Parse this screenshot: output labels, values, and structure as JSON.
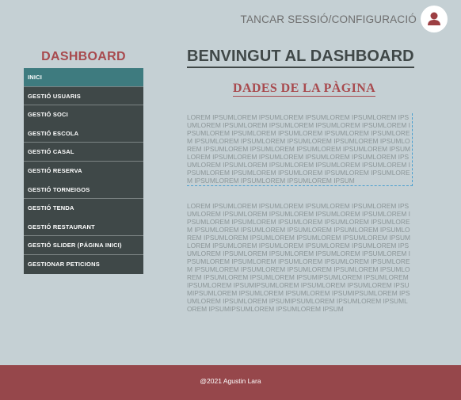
{
  "header": {
    "logout_label": "TANCAR SESSIÓ/CONFIGURACIÓ",
    "avatar_icon": "user-icon"
  },
  "sidebar": {
    "title": "DASHBOARD",
    "items": [
      {
        "label": "INICI",
        "active": true
      },
      {
        "label": "GESTIÓ USUARIS"
      },
      {
        "label": "GESTIÓ SOCI"
      },
      {
        "label": "GESTIÓ ESCOLA"
      },
      {
        "label": "GESTIÓ CASAL"
      },
      {
        "label": "GESTIÓ RESERVA"
      },
      {
        "label": "GESTIÓ TORNEIGOS"
      },
      {
        "label": "GESTIÓ TENDA"
      },
      {
        "label": "GESTIÓ RESTAURANT"
      },
      {
        "label": "GESTIÓ SLIDER (PÁGINA INICI)"
      },
      {
        "label": "GESTIONAR PETICIONS"
      }
    ]
  },
  "main": {
    "title": "BENVINGUT AL DASHBOARD",
    "section_title": "DADES DE LA PÀGINA",
    "paragraph1": "LOREM IPSUMLOREM IPSUMLOREM IPSUMLOREM IPSUMLOREM IPSUMLOREM IPSUMLOREM IPSUMLOREM IPSUMLOREM IPSUMLOREM IPSUMLOREM IPSUMLOREM IPSUMLOREM IPSUMLOREM IPSUMLOREM IPSUMLOREM IPSUMLOREM IPSUMLOREM IPSUMLOREM IPSUMLOREM IPSUMLOREM IPSUMLOREM IPSUMLOREM IPSUMLOREM IPSUMLOREM IPSUMLOREM IPSUMLOREM IPSUMLOREM IPSUMLOREM IPSUMLOREM IPSUMLOREM IPSUMLOREM IPSUMLOREM IPSUMLOREM IPSUMLOREM IPSUMLOREM IPSUMLOREM IPSUMLOREM IPSUMLOREM IPSUMLOREM IPSUMLOREM IPSUMLOREM IPSUM",
    "paragraph2": "LOREM IPSUMLOREM IPSUMLOREM IPSUMLOREM IPSUMLOREM IPSUMLOREM IPSUMLOREM IPSUMLOREM IPSUMLOREM IPSUMLOREM IPSUMLOREM IPSUMLOREM IPSUMLOREM IPSUMLOREM IPSUMLOREM IPSUMLOREM IPSUMLOREM IPSUMLOREM IPSUMLOREM IPSUMLOREM IPSUMLOREM IPSUMLOREM IPSUMLOREM IPSUMLOREM IPSUMLOREM IPSUMLOREM IPSUMLOREM IPSUMLOREM IPSUMLOREM IPSUMLOREM IPSUMLOREM IPSUMLOREM IPSUMLOREM IPSUMLOREM IPSUMLOREM IPSUMLOREM IPSUMLOREM IPSUMLOREM IPSUMLOREM IPSUMLOREM IPSUMLOREM IPSUMLOREM IPSUMLOREM IPSUMLOREM IPSUMLOREM IPSUMLOREM IPSUMIPSUMLOREM IPSUMLOREM IPSUMLOREM IPSUMIPSUMLOREM IPSUMLOREM IPSUMLOREM IPSUMIPSUMLOREM IPSUMLOREM IPSUMLOREM IPSUMIPSUMLOREM IPSUMLOREM IPSUMLOREM IPSUMIPSUMLOREM IPSUMLOREM IPSUMLOREM IPSUMIPSUMLOREM IPSUMLOREM IPSUM"
  },
  "footer": {
    "text": "@2021 Agustin Lara"
  },
  "colors": {
    "background": "#c5d0d4",
    "accent_red": "#a84a4e",
    "footer_bg": "#96474b",
    "sidebar_bg": "#3f4848",
    "sidebar_active": "#3e7b7f",
    "title_color": "#404848"
  }
}
